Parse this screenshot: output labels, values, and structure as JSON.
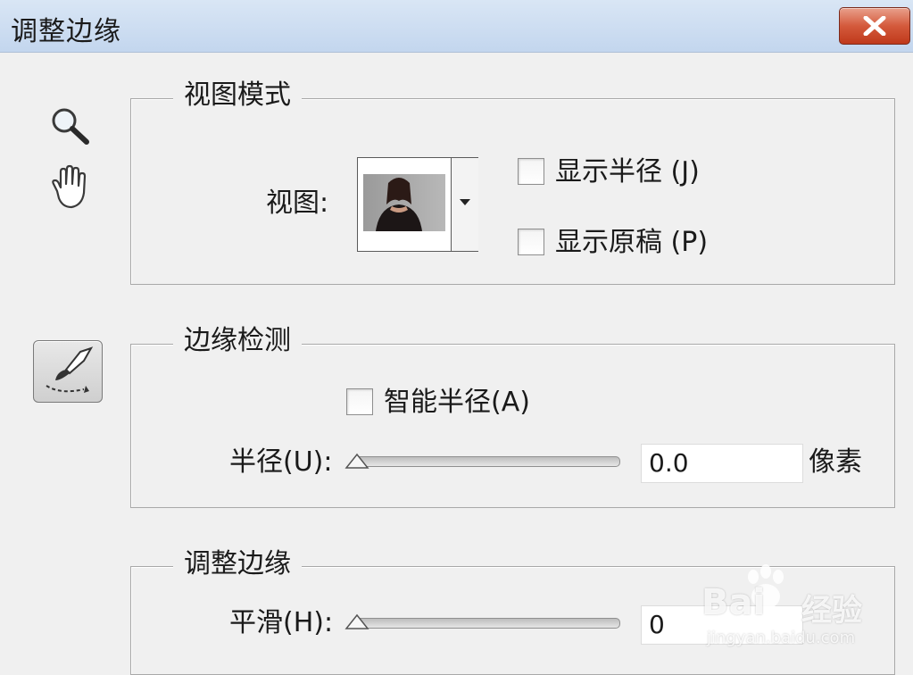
{
  "window": {
    "title": "调整边缘"
  },
  "tools": {
    "zoom": "zoom-icon",
    "hand": "hand-icon",
    "brush": "refine-radius-brush-icon"
  },
  "view_mode": {
    "legend": "视图模式",
    "view_label": "视图:",
    "show_radius": {
      "label": "显示半径 (J)",
      "checked": false
    },
    "show_original": {
      "label": "显示原稿 (P)",
      "checked": false
    }
  },
  "edge_detection": {
    "legend": "边缘检测",
    "smart_radius": {
      "label": "智能半径(A)",
      "checked": false
    },
    "radius_label": "半径(U):",
    "radius_value": "0.0",
    "radius_unit": "像素",
    "radius_slider_fraction": 0
  },
  "adjust_edge": {
    "legend": "调整边缘",
    "smooth_label": "平滑(H):",
    "smooth_value": "0",
    "smooth_slider_fraction": 0
  },
  "watermark": {
    "brand": "Bai",
    "brand2": "经验",
    "url": "jingyan.baidu.com"
  },
  "colors": {
    "close_button": "#d45a3c",
    "titlebar": "#c3d6ee",
    "dialog_bg": "#f0f0f0"
  }
}
